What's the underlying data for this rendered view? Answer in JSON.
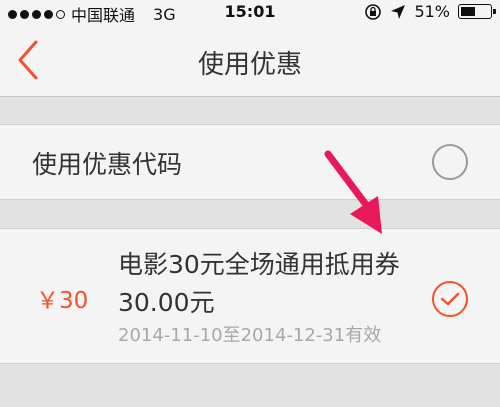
{
  "status_bar": {
    "carrier": "中国联通",
    "network": "3G",
    "time": "15:01",
    "battery": "51%",
    "battery_level": 0.51
  },
  "nav": {
    "title": "使用优惠"
  },
  "options": {
    "use_code_label": "使用优惠代码"
  },
  "coupon": {
    "price": "￥30",
    "name": "电影30元全场通用抵用券",
    "amount": "30.00元",
    "validity": "2014-11-10至2014-12-31有效",
    "selected": true
  },
  "colors": {
    "accent": "#f0522b",
    "annotation_arrow": "#e8185a"
  }
}
